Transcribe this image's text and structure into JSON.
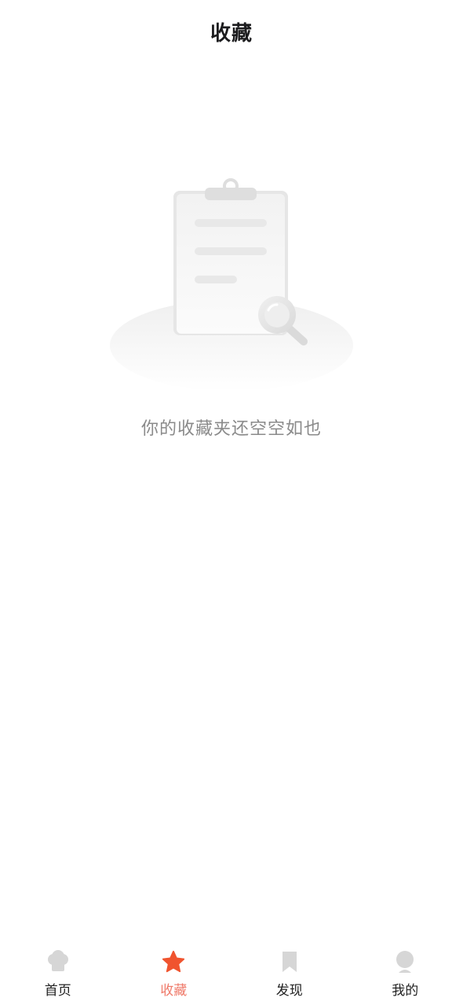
{
  "header": {
    "title": "收藏"
  },
  "empty_state": {
    "message": "你的收藏夹还空空如也",
    "illustration": "clipboard-magnifier-icon"
  },
  "tabbar": {
    "items": [
      {
        "label": "首页",
        "icon": "chef-hat-icon",
        "active": false
      },
      {
        "label": "收藏",
        "icon": "star-icon",
        "active": true
      },
      {
        "label": "发现",
        "icon": "bookmark-icon",
        "active": false
      },
      {
        "label": "我的",
        "icon": "user-icon",
        "active": false
      }
    ],
    "active_color": "#f0542f",
    "inactive_icon_color": "#d6d6d6"
  }
}
